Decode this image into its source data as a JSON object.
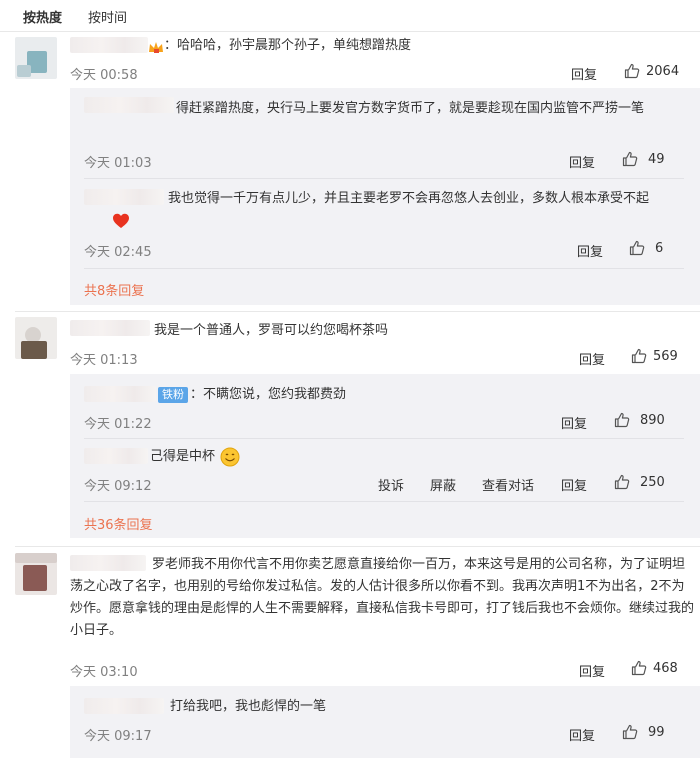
{
  "sort": {
    "hot": "按热度",
    "time": "按时间"
  },
  "comments": [
    {
      "text": "：哈哈哈，孙宇晨那个孙子，单纯想蹭热度",
      "time": "今天 00:58",
      "reply": "回复",
      "likes": "2064",
      "replies": [
        {
          "text": "得赶紧蹭热度，央行马上要发官方数字货币了，就是要趁现在国内监管不严捞一笔",
          "time": "今天 01:03",
          "reply": "回复",
          "likes": "49"
        },
        {
          "text": "我也觉得一千万有点儿少，并且主要老罗不会再忽悠人去创业，多数人根本承受不起",
          "time": "今天 02:45",
          "reply": "回复",
          "likes": "6"
        }
      ],
      "more": "共8条回复"
    },
    {
      "text": "我是一个普通人，罗哥可以约您喝杯茶吗",
      "time": "今天 01:13",
      "reply": "回复",
      "likes": "569",
      "replies": [
        {
          "badge": "铁粉",
          "text": "：不瞒您说，您约我都费劲",
          "time": "今天 01:22",
          "reply": "回复",
          "likes": "890"
        },
        {
          "text": "己得是中杯",
          "time": "今天 09:12",
          "report": "投诉",
          "block": "屏蔽",
          "dialog": "查看对话",
          "reply": "回复",
          "likes": "250"
        }
      ],
      "more": "共36条回复"
    },
    {
      "text": "罗老师我不用你代言不用你卖艺愿意直接给你一百万，本来这号是用的公司名称，为了证明坦荡之心改了名字，也用别的号给你发过私信。发的人估计很多所以你看不到。我再次声明1不为出名，2不为炒作。愿意拿钱的理由是彪悍的人生不需要解释，直接私信我卡号即可，打了钱后我也不会烦你。继续过我的小日子。",
      "time": "今天 03:10",
      "reply": "回复",
      "likes": "468",
      "replies": [
        {
          "text": "打给我吧，我也彪悍的一笔",
          "time": "今天 09:17",
          "reply": "回复",
          "likes": "99"
        }
      ]
    }
  ],
  "colors": {
    "accent": "#eb7350",
    "badge": "#5ba5e8",
    "reply_bg": "#f2f2f5",
    "meta": "#808080"
  }
}
